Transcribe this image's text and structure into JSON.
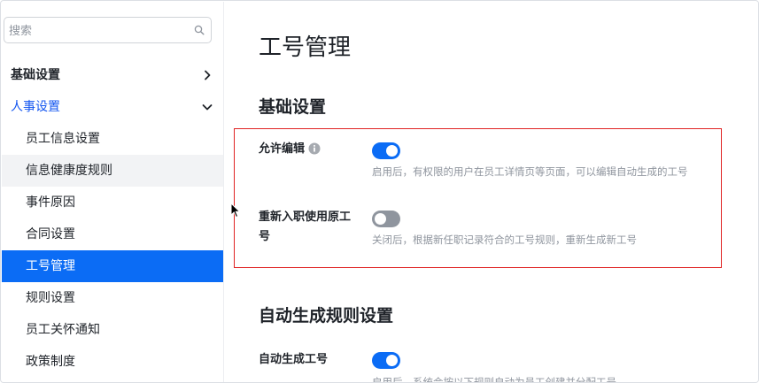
{
  "sidebar": {
    "search": {
      "placeholder": "搜索",
      "value": ""
    },
    "groups": [
      {
        "label": "基础设置",
        "expanded": false
      },
      {
        "label": "人事设置",
        "expanded": true
      }
    ],
    "items": [
      {
        "label": "员工信息设置"
      },
      {
        "label": "信息健康度规则"
      },
      {
        "label": "事件原因"
      },
      {
        "label": "合同设置"
      },
      {
        "label": "工号管理"
      },
      {
        "label": "规则设置"
      },
      {
        "label": "员工关怀通知"
      },
      {
        "label": "政策制度"
      }
    ],
    "selected_index": 4,
    "hovered_index": 1
  },
  "main": {
    "title": "工号管理",
    "sections": [
      {
        "title": "基础设置",
        "settings": [
          {
            "label": "允许编辑",
            "has_info_icon": true,
            "enabled": true,
            "description": "启用后，有权限的用户在员工详情页等页面，可以编辑自动生成的工号"
          },
          {
            "label": "重新入职使用原工号",
            "has_info_icon": false,
            "enabled": false,
            "description": "关闭后，根据新任职记录符合的工号规则，重新生成新工号"
          }
        ]
      },
      {
        "title": "自动生成规则设置",
        "settings": [
          {
            "label": "自动生成工号",
            "has_info_icon": false,
            "enabled": true,
            "description": "启用后，系统会按以下规则自动为员工创建并分配工号"
          }
        ]
      }
    ]
  },
  "colors": {
    "accent": "#0b6cf5",
    "active_group_text": "#1456f0",
    "toggle_off": "#8f959e",
    "highlight_box": "#e02424",
    "muted_text": "#8f959e"
  },
  "icons": {
    "search": "search-icon",
    "chevron_right": "chevron-right-icon",
    "chevron_down": "chevron-down-icon",
    "info": "info-icon",
    "cursor": "mouse-pointer-icon"
  }
}
